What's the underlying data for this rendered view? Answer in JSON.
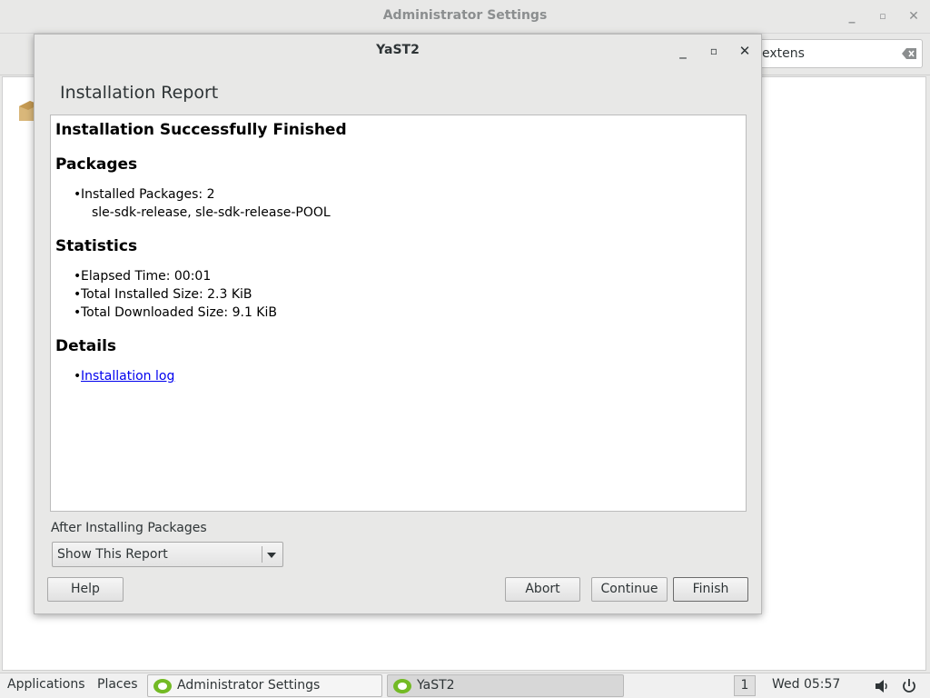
{
  "background_window": {
    "title": "Administrator Settings",
    "search_value": "extens",
    "controls": [
      "minimize-icon",
      "maximize-icon",
      "close-icon"
    ]
  },
  "dialog": {
    "title": "YaST2",
    "heading": "Installation Report",
    "report": {
      "title": "Installation Successfully Finished",
      "sections": [
        {
          "heading": "Packages",
          "items": [
            "Installed Packages: 2"
          ],
          "extra": "sle-sdk-release, sle-sdk-release-POOL"
        },
        {
          "heading": "Statistics",
          "items": [
            "Elapsed Time: 00:01",
            "Total Installed Size: 2.3 KiB",
            "Total Downloaded Size: 9.1 KiB"
          ]
        },
        {
          "heading": "Details",
          "items": [
            "Installation log"
          ]
        }
      ]
    },
    "after_label": "After Installing Packages",
    "after_select": "Show This Report",
    "buttons": {
      "help": "Help",
      "abort": "Abort",
      "continue": "Continue",
      "finish": "Finish"
    }
  },
  "taskbar": {
    "applications": "Applications",
    "places": "Places",
    "tasks": [
      "Administrator Settings",
      "YaST2"
    ],
    "workspace": "1",
    "clock": "Wed 05:57",
    "icons": [
      "volume-icon",
      "power-icon"
    ]
  }
}
